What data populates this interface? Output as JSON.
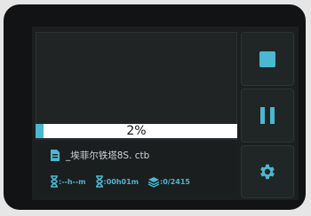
{
  "progress": {
    "value": 0.02,
    "label": "2%"
  },
  "file": {
    "name": "_埃菲尔铁塔8S. ctb"
  },
  "status": {
    "remaining_time": ":--h--m",
    "elapsed_time": ":00h01m",
    "layers": ":0/2415"
  },
  "buttons": {
    "stop": "stop",
    "pause": "pause",
    "settings": "settings"
  },
  "colors": {
    "accent": "#4cb7d1",
    "background": "#1b1f20",
    "bezel": "#111314"
  },
  "icons": [
    "file-icon",
    "hourglass-icon",
    "hourglass-icon",
    "layers-icon",
    "stop-icon",
    "pause-icon",
    "gear-icon"
  ]
}
